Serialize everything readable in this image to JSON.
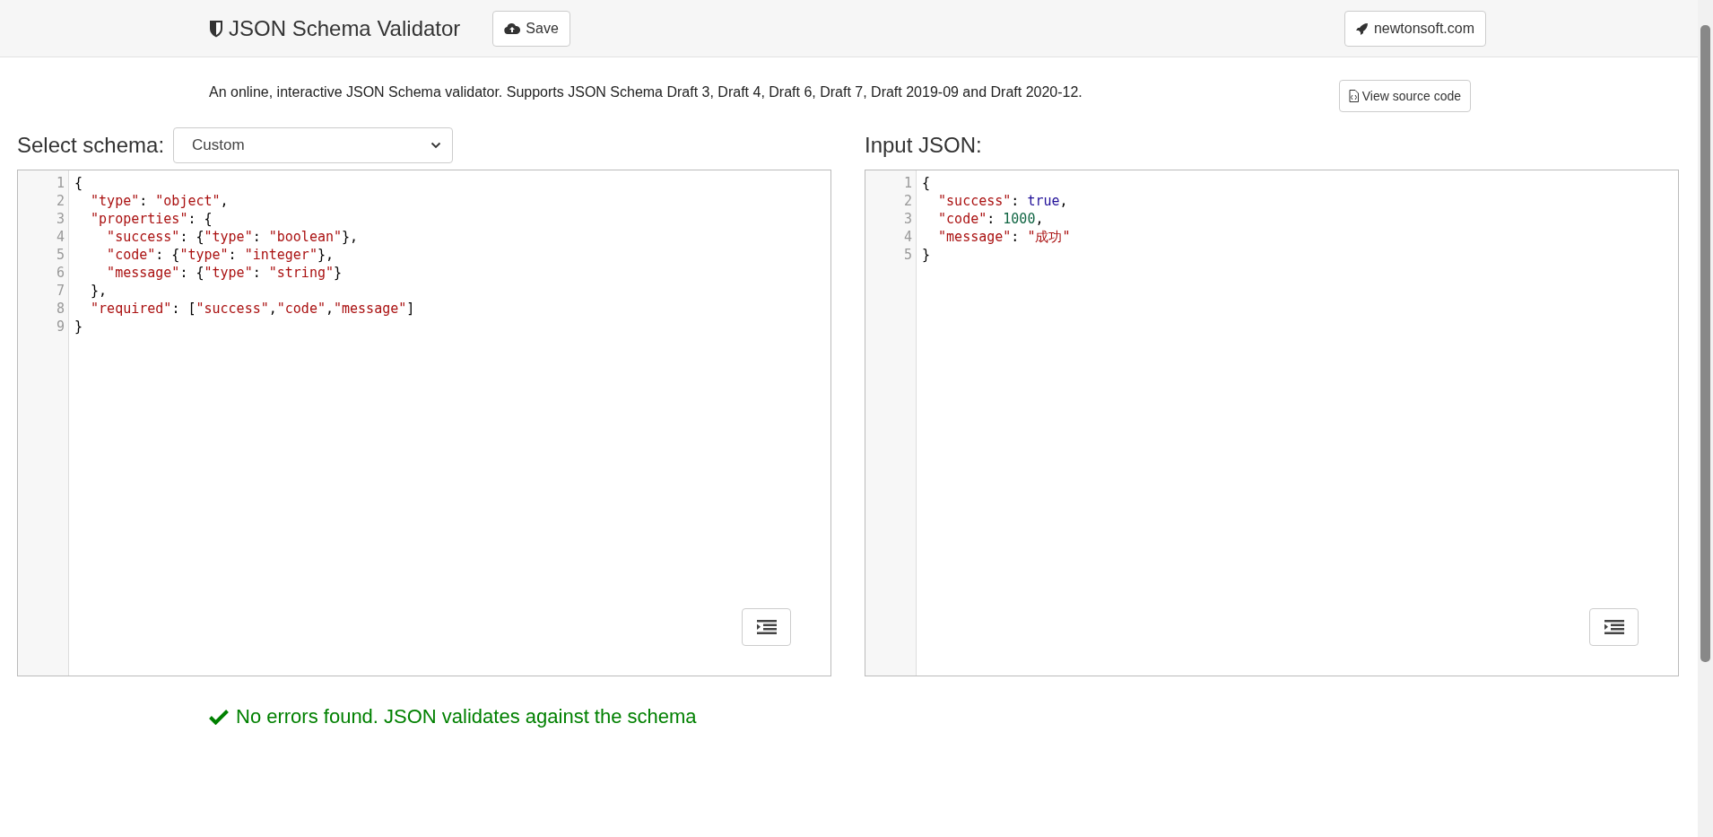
{
  "header": {
    "title": "JSON Schema Validator",
    "save_button": "Save",
    "site_link": "newtonsoft.com"
  },
  "description": "An online, interactive JSON Schema validator. Supports JSON Schema Draft 3, Draft 4, Draft 6, Draft 7, Draft 2019-09 and Draft 2020-12.",
  "view_source_button": "View source code",
  "schema_panel": {
    "label": "Select schema:",
    "select_value": "Custom",
    "lines": [
      [
        {
          "kind": "punct",
          "text": "{"
        }
      ],
      [
        {
          "kind": "key",
          "text": "  \"type\""
        },
        {
          "kind": "punct",
          "text": ": "
        },
        {
          "kind": "string",
          "text": "\"object\""
        },
        {
          "kind": "punct",
          "text": ","
        }
      ],
      [
        {
          "kind": "key",
          "text": "  \"properties\""
        },
        {
          "kind": "punct",
          "text": ": {"
        }
      ],
      [
        {
          "kind": "key",
          "text": "    \"success\""
        },
        {
          "kind": "punct",
          "text": ": {"
        },
        {
          "kind": "key",
          "text": "\"type\""
        },
        {
          "kind": "punct",
          "text": ": "
        },
        {
          "kind": "string",
          "text": "\"boolean\""
        },
        {
          "kind": "punct",
          "text": "},"
        }
      ],
      [
        {
          "kind": "key",
          "text": "    \"code\""
        },
        {
          "kind": "punct",
          "text": ": {"
        },
        {
          "kind": "key",
          "text": "\"type\""
        },
        {
          "kind": "punct",
          "text": ": "
        },
        {
          "kind": "string",
          "text": "\"integer\""
        },
        {
          "kind": "punct",
          "text": "},"
        }
      ],
      [
        {
          "kind": "key",
          "text": "    \"message\""
        },
        {
          "kind": "punct",
          "text": ": {"
        },
        {
          "kind": "key",
          "text": "\"type\""
        },
        {
          "kind": "punct",
          "text": ": "
        },
        {
          "kind": "string",
          "text": "\"string\""
        },
        {
          "kind": "punct",
          "text": "}"
        }
      ],
      [
        {
          "kind": "punct",
          "text": "  },"
        }
      ],
      [
        {
          "kind": "key",
          "text": "  \"required\""
        },
        {
          "kind": "punct",
          "text": ": ["
        },
        {
          "kind": "string",
          "text": "\"success\""
        },
        {
          "kind": "punct",
          "text": ","
        },
        {
          "kind": "string",
          "text": "\"code\""
        },
        {
          "kind": "punct",
          "text": ","
        },
        {
          "kind": "string",
          "text": "\"message\""
        },
        {
          "kind": "punct",
          "text": "]"
        }
      ],
      [
        {
          "kind": "punct",
          "text": "}"
        }
      ]
    ],
    "line_numbers": [
      "1",
      "2",
      "3",
      "4",
      "5",
      "6",
      "7",
      "8",
      "9"
    ]
  },
  "input_panel": {
    "label": "Input JSON:",
    "lines": [
      [
        {
          "kind": "punct",
          "text": "{"
        }
      ],
      [
        {
          "kind": "key",
          "text": "  \"success\""
        },
        {
          "kind": "punct",
          "text": ": "
        },
        {
          "kind": "bool",
          "text": "true"
        },
        {
          "kind": "punct",
          "text": ","
        }
      ],
      [
        {
          "kind": "key",
          "text": "  \"code\""
        },
        {
          "kind": "punct",
          "text": ": "
        },
        {
          "kind": "number",
          "text": "1000"
        },
        {
          "kind": "punct",
          "text": ","
        }
      ],
      [
        {
          "kind": "key",
          "text": "  \"message\""
        },
        {
          "kind": "punct",
          "text": ": "
        },
        {
          "kind": "string",
          "text": "\"成功\""
        }
      ],
      [
        {
          "kind": "punct",
          "text": "}"
        }
      ]
    ],
    "line_numbers": [
      "1",
      "2",
      "3",
      "4",
      "5"
    ]
  },
  "status": {
    "kind": "success",
    "text": "No errors found. JSON validates against the schema"
  }
}
